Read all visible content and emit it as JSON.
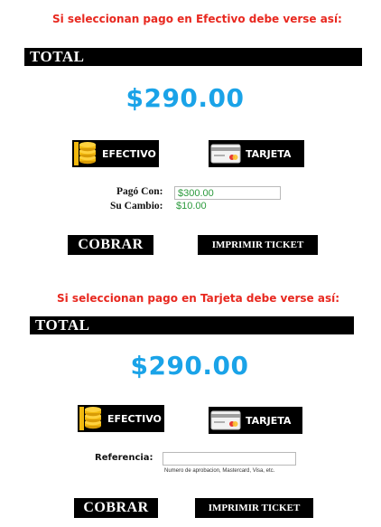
{
  "sections": [
    {
      "caption": "Si seleccionan pago en Efectivo debe verse así:",
      "total_label": "TOTAL",
      "amount": "$290.00",
      "efectivo_label": "EFECTIVO",
      "tarjeta_label": "TARJETA",
      "pago_con_label": "Pagó Con:",
      "pago_con_value": "$300.00",
      "cambio_label": "Su Cambio:",
      "cambio_value": "$10.00",
      "cobrar_label": "COBRAR",
      "imprimir_label": "IMPRIMIR TICKET"
    },
    {
      "caption": "Si seleccionan pago en Tarjeta debe verse así:",
      "total_label": "TOTAL",
      "amount": "$290.00",
      "efectivo_label": "EFECTIVO",
      "tarjeta_label": "TARJETA",
      "referencia_label": "Referencia:",
      "referencia_value": "",
      "referencia_hint": "Numero de aprobacion, Mastercard, Visa, etc.",
      "cobrar_label": "COBRAR",
      "imprimir_label": "IMPRIMIR TICKET"
    }
  ],
  "colors": {
    "caption": "#e8281f",
    "amount": "#1aa3e8",
    "money_text": "#2b9a3c",
    "coin": "#f2b90f",
    "button_bg": "#000000"
  },
  "icons": {
    "efectivo": "coin-stack-icon",
    "tarjeta": "credit-card-icon"
  }
}
